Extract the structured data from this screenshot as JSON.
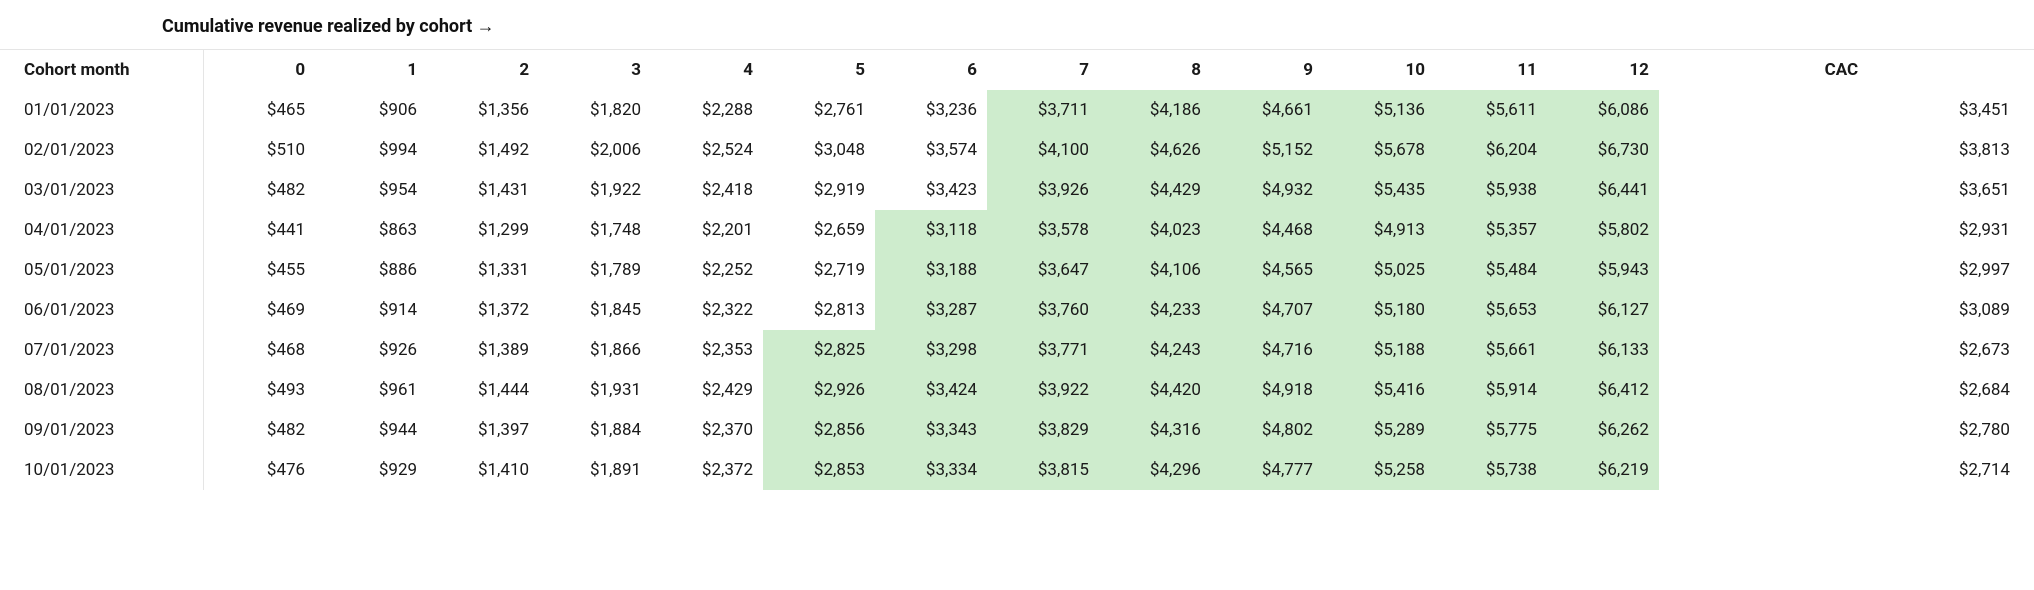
{
  "title": "Cumulative revenue realized by cohort →",
  "headers": {
    "cohort": "Cohort month",
    "periods": [
      "0",
      "1",
      "2",
      "3",
      "4",
      "5",
      "6",
      "7",
      "8",
      "9",
      "10",
      "11",
      "12"
    ],
    "cac": "CAC"
  },
  "rows": [
    {
      "cohort": "01/01/2023",
      "values": [
        "$465",
        "$906",
        "$1,356",
        "$1,820",
        "$2,288",
        "$2,761",
        "$3,236",
        "$3,711",
        "$4,186",
        "$4,661",
        "$5,136",
        "$5,611",
        "$6,086"
      ],
      "cac": "$3,451",
      "highlight_start": 7
    },
    {
      "cohort": "02/01/2023",
      "values": [
        "$510",
        "$994",
        "$1,492",
        "$2,006",
        "$2,524",
        "$3,048",
        "$3,574",
        "$4,100",
        "$4,626",
        "$5,152",
        "$5,678",
        "$6,204",
        "$6,730"
      ],
      "cac": "$3,813",
      "highlight_start": 7
    },
    {
      "cohort": "03/01/2023",
      "values": [
        "$482",
        "$954",
        "$1,431",
        "$1,922",
        "$2,418",
        "$2,919",
        "$3,423",
        "$3,926",
        "$4,429",
        "$4,932",
        "$5,435",
        "$5,938",
        "$6,441"
      ],
      "cac": "$3,651",
      "highlight_start": 7
    },
    {
      "cohort": "04/01/2023",
      "values": [
        "$441",
        "$863",
        "$1,299",
        "$1,748",
        "$2,201",
        "$2,659",
        "$3,118",
        "$3,578",
        "$4,023",
        "$4,468",
        "$4,913",
        "$5,357",
        "$5,802"
      ],
      "cac": "$2,931",
      "highlight_start": 6
    },
    {
      "cohort": "05/01/2023",
      "values": [
        "$455",
        "$886",
        "$1,331",
        "$1,789",
        "$2,252",
        "$2,719",
        "$3,188",
        "$3,647",
        "$4,106",
        "$4,565",
        "$5,025",
        "$5,484",
        "$5,943"
      ],
      "cac": "$2,997",
      "highlight_start": 6
    },
    {
      "cohort": "06/01/2023",
      "values": [
        "$469",
        "$914",
        "$1,372",
        "$1,845",
        "$2,322",
        "$2,813",
        "$3,287",
        "$3,760",
        "$4,233",
        "$4,707",
        "$5,180",
        "$5,653",
        "$6,127"
      ],
      "cac": "$3,089",
      "highlight_start": 6
    },
    {
      "cohort": "07/01/2023",
      "values": [
        "$468",
        "$926",
        "$1,389",
        "$1,866",
        "$2,353",
        "$2,825",
        "$3,298",
        "$3,771",
        "$4,243",
        "$4,716",
        "$5,188",
        "$5,661",
        "$6,133"
      ],
      "cac": "$2,673",
      "highlight_start": 5
    },
    {
      "cohort": "08/01/2023",
      "values": [
        "$493",
        "$961",
        "$1,444",
        "$1,931",
        "$2,429",
        "$2,926",
        "$3,424",
        "$3,922",
        "$4,420",
        "$4,918",
        "$5,416",
        "$5,914",
        "$6,412"
      ],
      "cac": "$2,684",
      "highlight_start": 5
    },
    {
      "cohort": "09/01/2023",
      "values": [
        "$482",
        "$944",
        "$1,397",
        "$1,884",
        "$2,370",
        "$2,856",
        "$3,343",
        "$3,829",
        "$4,316",
        "$4,802",
        "$5,289",
        "$5,775",
        "$6,262"
      ],
      "cac": "$2,780",
      "highlight_start": 5
    },
    {
      "cohort": "10/01/2023",
      "values": [
        "$476",
        "$929",
        "$1,410",
        "$1,891",
        "$2,372",
        "$2,853",
        "$3,334",
        "$3,815",
        "$4,296",
        "$4,777",
        "$5,258",
        "$5,738",
        "$6,219"
      ],
      "cac": "$2,714",
      "highlight_start": 5
    }
  ]
}
